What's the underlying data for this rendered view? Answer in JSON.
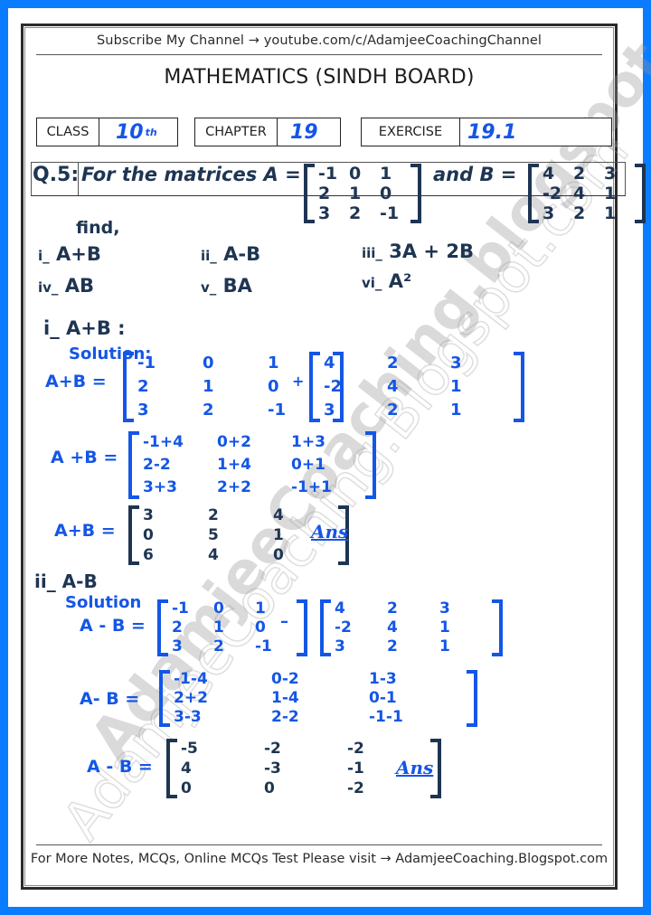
{
  "header": {
    "subscribe_text": "Subscribe My Channel → youtube.com/c/AdamjeeCoachingChannel",
    "title": "MATHEMATICS (SINDH BOARD)",
    "class_label": "CLASS",
    "class_value": "10",
    "class_suffix": "th",
    "chapter_label": "CHAPTER",
    "chapter_value": "19",
    "exercise_label": "EXERCISE",
    "exercise_value": "19.1"
  },
  "question": {
    "number": "Q.5:",
    "text": "For the matrices A =",
    "and_text": "and B =",
    "matrix_A": [
      [
        "-1",
        "0",
        "1"
      ],
      [
        "2",
        "1",
        "0"
      ],
      [
        "3",
        "2",
        "-1"
      ]
    ],
    "matrix_B": [
      [
        "4",
        "2",
        "3"
      ],
      [
        "-2",
        "4",
        "1"
      ],
      [
        "3",
        "2",
        "1"
      ]
    ],
    "find_label": "find,",
    "parts": [
      {
        "num": "i_",
        "expr": "A+B"
      },
      {
        "num": "ii_",
        "expr": "A-B"
      },
      {
        "num": "iii_",
        "expr": "3A + 2B"
      },
      {
        "num": "iv_",
        "expr": "AB"
      },
      {
        "num": "v_",
        "expr": "BA"
      },
      {
        "num": "vi_",
        "expr": "A²"
      }
    ]
  },
  "solution_i": {
    "heading": "i_ A+B :",
    "solution_label": "Solution:",
    "lhs": "A+B =",
    "plus": "+",
    "step1_A": [
      [
        "-1",
        "0",
        "1"
      ],
      [
        "2",
        "1",
        "0"
      ],
      [
        "3",
        "2",
        "-1"
      ]
    ],
    "step1_B": [
      [
        "4",
        "2",
        "3"
      ],
      [
        "-2",
        "4",
        "1"
      ],
      [
        "3",
        "2",
        "1"
      ]
    ],
    "step2_lhs": "A +B =",
    "step2": [
      [
        "-1+4",
        "0+2",
        "1+3"
      ],
      [
        "2-2",
        "1+4",
        "0+1"
      ],
      [
        "3+3",
        "2+2",
        "-1+1"
      ]
    ],
    "result_lhs": "A+B =",
    "result": [
      [
        "3",
        "2",
        "4"
      ],
      [
        "0",
        "5",
        "1"
      ],
      [
        "6",
        "4",
        "0"
      ]
    ],
    "ans_label": "Ans"
  },
  "solution_ii": {
    "heading": "ii_ A-B",
    "solution_label": "Solution",
    "lhs": "A - B =",
    "minus": "–",
    "step1_A": [
      [
        "-1",
        "0",
        "1"
      ],
      [
        "2",
        "1",
        "0"
      ],
      [
        "3",
        "2",
        "-1"
      ]
    ],
    "step1_B": [
      [
        "4",
        "2",
        "3"
      ],
      [
        "-2",
        "4",
        "1"
      ],
      [
        "3",
        "2",
        "1"
      ]
    ],
    "step2_lhs": "A- B =",
    "step2": [
      [
        "-1-4",
        "0-2",
        "1-3"
      ],
      [
        "2+2",
        "1-4",
        "0-1"
      ],
      [
        "3-3",
        "2-2",
        "-1-1"
      ]
    ],
    "result_lhs": "A - B =",
    "result": [
      [
        "-5",
        "-2",
        "-2"
      ],
      [
        "4",
        "-3",
        "-1"
      ],
      [
        "0",
        "0",
        "-2"
      ]
    ],
    "ans_label": "Ans"
  },
  "watermark": {
    "bold_text": "AdamjeeCoaching.blogspot.com",
    "outline_text": "AdamjeeCoaching.Blogspot.com"
  },
  "footer": {
    "text": "For More Notes, MCQs, Online MCQs Test Please visit → AdamjeeCoaching.Blogspot.com"
  },
  "colors": {
    "frame": "#0a7cff",
    "blue_ink": "#1456e6",
    "dark_ink": "#1e3552"
  }
}
